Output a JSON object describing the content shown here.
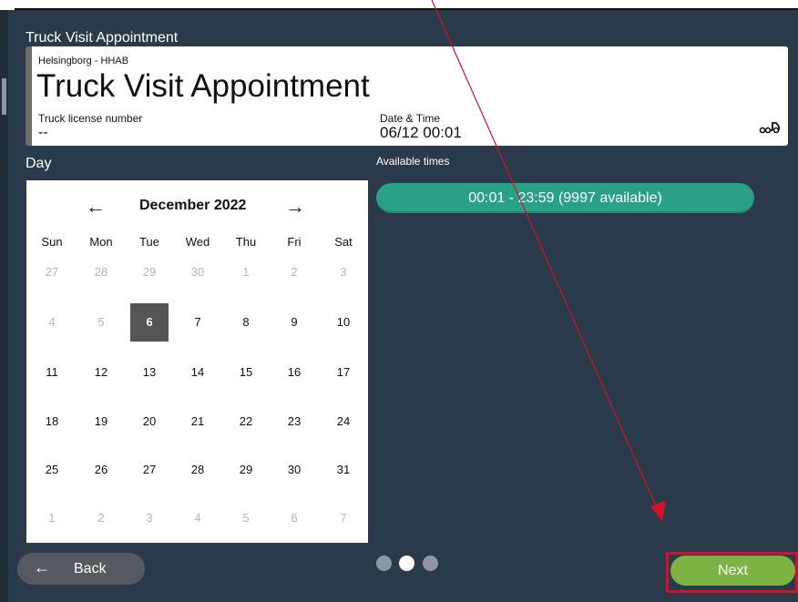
{
  "window_title": "Truck Visit Appointment",
  "header": {
    "terminal": "Helsingborg - HHAB",
    "title": "Truck Visit Appointment",
    "license_label": "Truck license number",
    "license_value": "--",
    "datetime_label": "Date & Time",
    "datetime_value": "06/12 00:01"
  },
  "day_label": "Day",
  "available_times_label": "Available times",
  "calendar": {
    "prev": "←",
    "month": "December 2022",
    "next": "→",
    "weekdays": [
      "Sun",
      "Mon",
      "Tue",
      "Wed",
      "Thu",
      "Fri",
      "Sat"
    ],
    "weeks": [
      [
        {
          "d": "27",
          "m": true
        },
        {
          "d": "28",
          "m": true
        },
        {
          "d": "29",
          "m": true
        },
        {
          "d": "30",
          "m": true
        },
        {
          "d": "1",
          "m": true
        },
        {
          "d": "2",
          "m": true
        },
        {
          "d": "3",
          "m": true
        }
      ],
      [
        {
          "d": "4",
          "m": true
        },
        {
          "d": "5",
          "m": true
        },
        {
          "d": "6",
          "sel": true
        },
        {
          "d": "7"
        },
        {
          "d": "8"
        },
        {
          "d": "9"
        },
        {
          "d": "10"
        }
      ],
      [
        {
          "d": "11"
        },
        {
          "d": "12"
        },
        {
          "d": "13"
        },
        {
          "d": "14"
        },
        {
          "d": "15"
        },
        {
          "d": "16"
        },
        {
          "d": "17"
        }
      ],
      [
        {
          "d": "18"
        },
        {
          "d": "19"
        },
        {
          "d": "20"
        },
        {
          "d": "21"
        },
        {
          "d": "22"
        },
        {
          "d": "23"
        },
        {
          "d": "24"
        }
      ],
      [
        {
          "d": "25"
        },
        {
          "d": "26"
        },
        {
          "d": "27"
        },
        {
          "d": "28"
        },
        {
          "d": "29"
        },
        {
          "d": "30"
        },
        {
          "d": "31"
        }
      ],
      [
        {
          "d": "1",
          "m": true
        },
        {
          "d": "2",
          "m": true
        },
        {
          "d": "3",
          "m": true
        },
        {
          "d": "4",
          "m": true
        },
        {
          "d": "5",
          "m": true
        },
        {
          "d": "6",
          "m": true
        },
        {
          "d": "7",
          "m": true
        }
      ]
    ],
    "selected_date": "6"
  },
  "time_slots": [
    {
      "label": "00:01 - 23:59 (9997 available)"
    }
  ],
  "footer": {
    "back_arrow": "←",
    "back_label": "Back",
    "next_label": "Next",
    "step_dots": [
      false,
      true,
      false
    ]
  },
  "colors": {
    "background": "#2b3a4b",
    "slot_green": "#2aa184",
    "next_green": "#7cb342",
    "back_gray": "#555a60",
    "annotation_red": "#d0132a"
  },
  "icons": {
    "truck": "truck-icon"
  }
}
